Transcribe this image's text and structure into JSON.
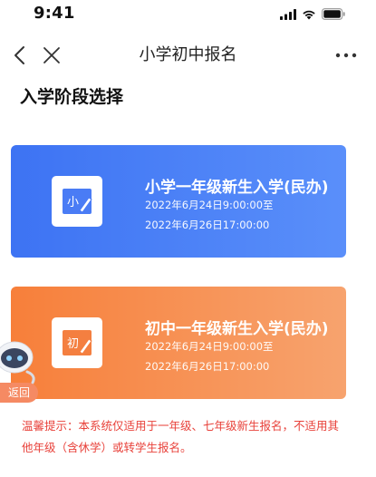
{
  "status_bar": {
    "time": "9:41",
    "icons": [
      "signal-icon",
      "wifi-icon",
      "battery-icon"
    ]
  },
  "nav": {
    "title": "小学初中报名",
    "back_icon": "back-chevron-icon",
    "close_icon": "close-icon",
    "more_icon": "more-dots-icon"
  },
  "section_title": "入学阶段选择",
  "cards": [
    {
      "title": "小学一年级新生入学(民办)",
      "date_start": "2022年6月24日9:00:00至",
      "date_end": "2022年6月26日17:00:00",
      "icon_char": "小",
      "color": "#3d73f3"
    },
    {
      "title": "初中一年级新生入学(民办)",
      "date_start": "2022年6月24日9:00:00至",
      "date_end": "2022年6月26日17:00:00",
      "icon_char": "初",
      "color": "#f77f3a"
    }
  ],
  "floating": {
    "back_label": "返回"
  },
  "notice": "温馨提示：本系统仅适用于一年级、七年级新生报名，不适用其他年级（含休学）或转学生报名。"
}
